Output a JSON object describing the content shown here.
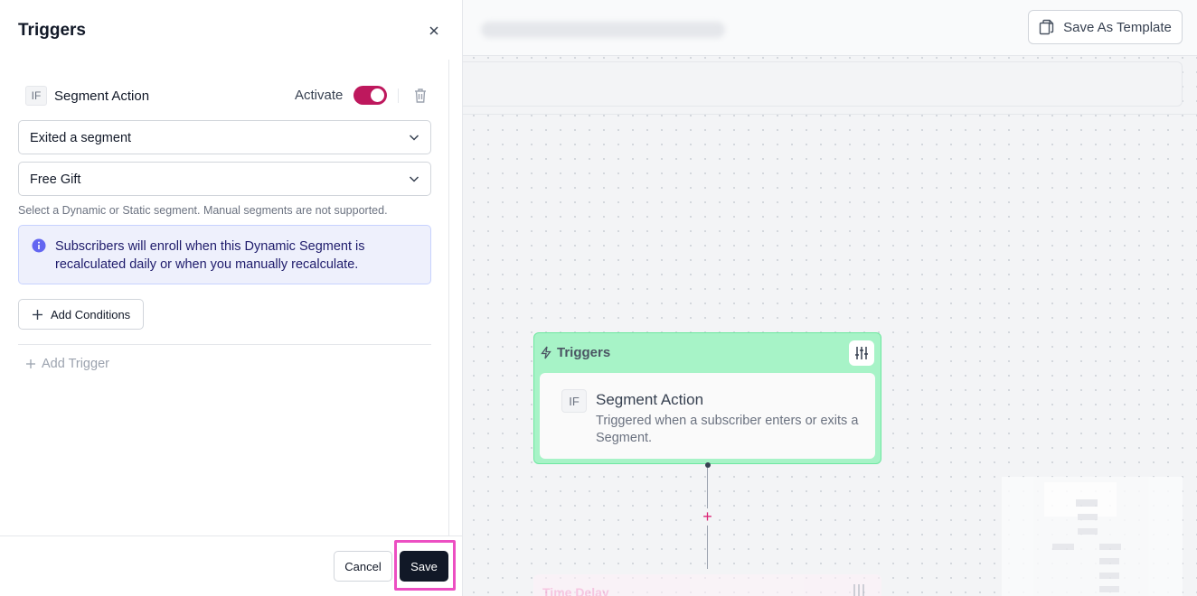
{
  "panel": {
    "title": "Triggers",
    "trigger": {
      "badge": "IF",
      "title": "Segment Action",
      "activate_label": "Activate",
      "activated": true
    },
    "action_select": {
      "value": "Exited a segment"
    },
    "segment_select": {
      "value": "Free Gift"
    },
    "helper_text": "Select a Dynamic or Static segment. Manual segments are not supported.",
    "info_text": "Subscribers will enroll when this Dynamic Segment is recalculated daily or when you manually recalculate.",
    "add_conditions_label": "Add Conditions",
    "add_trigger_label": "Add Trigger",
    "cancel_label": "Cancel",
    "save_label": "Save"
  },
  "canvas": {
    "save_template_label": "Save As Template",
    "node": {
      "header": "Triggers",
      "badge": "IF",
      "title": "Segment Action",
      "description": "Triggered when a subscriber enters or exits a Segment."
    },
    "next_node_label": "Time Delay"
  },
  "colors": {
    "accent": "#be185d",
    "node_bg": "#a7f3c7",
    "info_bg": "#eef0fc",
    "highlight": "#ec4fc2",
    "primary_button": "#111827"
  }
}
